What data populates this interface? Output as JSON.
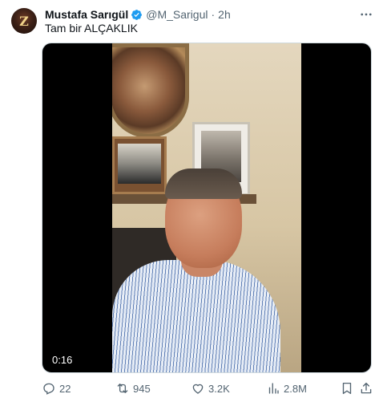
{
  "author": {
    "name": "Mustafa Sarıgül",
    "handle": "@M_Sarigul",
    "separator": "·",
    "time": "2h",
    "avatar_text": "Z",
    "verified": true
  },
  "tweet": {
    "text": "Tam bir ALÇAKLIK"
  },
  "media": {
    "type": "video",
    "duration": "0:16"
  },
  "metrics": {
    "replies": "22",
    "reposts": "945",
    "likes": "3.2K",
    "views": "2.8M"
  },
  "icons": {
    "verified": "verified-badge-icon",
    "more": "more-icon",
    "reply": "reply-icon",
    "repost": "repost-icon",
    "like": "like-icon",
    "views": "views-icon",
    "bookmark": "bookmark-icon",
    "share": "share-icon"
  },
  "colors": {
    "verified_blue": "#1d9bf0",
    "text_primary": "#0f1419",
    "text_secondary": "#536471",
    "media_border": "#cfd9de"
  }
}
